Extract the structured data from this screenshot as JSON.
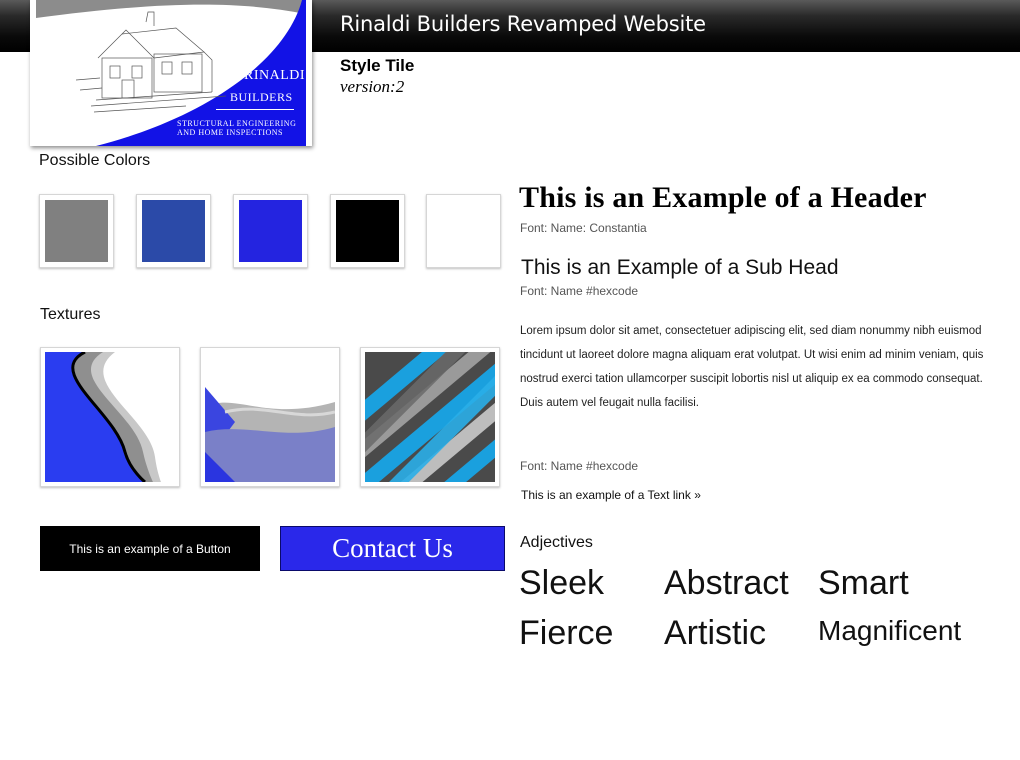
{
  "header": {
    "site_title": "Rinaldi Builders Revamped Website"
  },
  "logo": {
    "line1": "RINALDI",
    "line2": "BUILDERS",
    "tagline1": "STRUCTURAL ENGINEERING",
    "tagline2": "AND HOME INSPECTIONS",
    "colors": {
      "curve": "#1212e6",
      "shade": "#8c8c8c"
    }
  },
  "style_tile": {
    "title": "Style Tile",
    "version": "version:2"
  },
  "colors": {
    "label": "Possible Colors",
    "swatches": [
      "#808080",
      "#2b4aa8",
      "#2424e0",
      "#000000",
      "#ffffff"
    ]
  },
  "textures": {
    "label": "Textures"
  },
  "buttons": {
    "example_label": "This is an example of a Button",
    "contact_label": "Contact Us",
    "contact_color": "#2a28ea"
  },
  "typography": {
    "header_example": "This is an Example of a Header",
    "header_font_note": "Font: Name: Constantia",
    "subhead_example": "This is an Example of a Sub Head",
    "subhead_font_note": "Font: Name #hexcode",
    "body_text": "Lorem ipsum dolor sit amet, consectetuer adipiscing elit, sed diam nonummy nibh euismod tincidunt ut laoreet dolore magna aliquam erat volutpat. Ut wisi enim ad minim veniam, quis nostrud exerci tation ullamcorper suscipit lobortis nisl ut aliquip ex ea commodo consequat. Duis autem vel feugait nulla facilisi.",
    "body_font_note": "Font: Name #hexcode",
    "text_link": "This is an example of a Text link »"
  },
  "adjectives": {
    "label": "Adjectives",
    "words": [
      "Sleek",
      "Abstract",
      "Smart",
      "Fierce",
      "Artistic",
      "Magnificent"
    ]
  }
}
